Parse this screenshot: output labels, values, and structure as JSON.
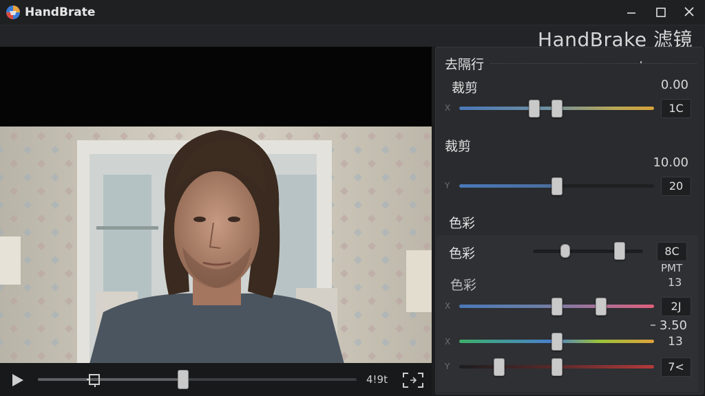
{
  "app": {
    "title": "HandBrate",
    "window_controls": [
      "minimize-icon",
      "maximize-icon",
      "close-icon"
    ]
  },
  "header": {
    "filters_title": "HandBrake 滤镜"
  },
  "player": {
    "time": "4!9t"
  },
  "panel": {
    "deinterlace_label": "去隔行",
    "crop1": {
      "label": "裁剪",
      "value": "0.00",
      "axis": "X",
      "box": "1C"
    },
    "crop2": {
      "label": "裁剪",
      "value": "10.00",
      "axis": "Y",
      "box": "20"
    },
    "color_section_label": "色彩",
    "color1": {
      "label": "色彩",
      "box": "8C",
      "unit": "PMT",
      "unit_value": "13"
    },
    "color2": {
      "label": "色彩",
      "axis": "X",
      "box": "2J"
    },
    "color3": {
      "value": "3.50",
      "axis": "X",
      "box_value": "13"
    },
    "color4": {
      "axis": "Y",
      "box": "7<"
    }
  },
  "colors": {
    "accent_blue": "#4a78b8",
    "title_bar": "#1f2022",
    "panel": "#2a2b2e"
  }
}
